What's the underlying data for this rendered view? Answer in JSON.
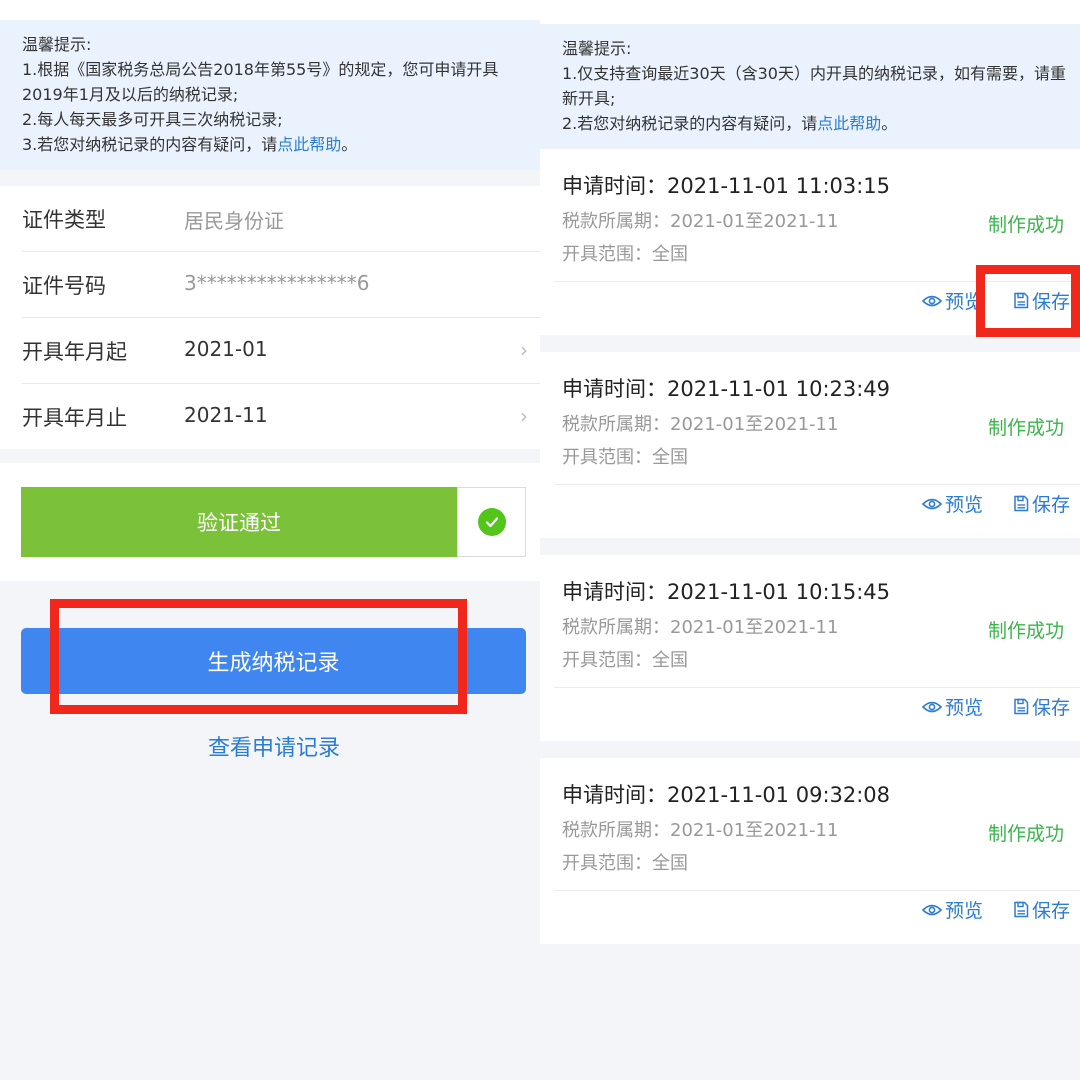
{
  "left": {
    "tips": {
      "title": "温馨提示:",
      "line1": "1.根据《国家税务总局公告2018年第55号》的规定，您可申请开具2019年1月及以后的纳税记录;",
      "line2": "2.每人每天最多可开具三次纳税记录;",
      "line3_prefix": "3.若您对纳税记录的内容有疑问，请",
      "line3_link": "点此帮助",
      "line3_suffix": "。"
    },
    "form": [
      {
        "label": "证件类型",
        "value": "居民身份证"
      },
      {
        "label": "证件号码",
        "value": "3****************6"
      },
      {
        "label": "开具年月起",
        "value": "2021-01"
      },
      {
        "label": "开具年月止",
        "value": "2021-11"
      }
    ],
    "verify_label": "验证通过",
    "generate_label": "生成纳税记录",
    "view_records_label": "查看申请记录"
  },
  "right": {
    "tips": {
      "title": "温馨提示:",
      "line1": "1.仅支持查询最近30天（含30天）内开具的纳税记录，如有需要，请重新开具;",
      "line2_prefix": "2.若您对纳税记录的内容有疑问，请",
      "line2_link": "点此帮助",
      "line2_suffix": "。"
    },
    "records": [
      {
        "time": "申请时间：2021-11-01 11:03:15",
        "period": "税款所属期：2021-01至2021-11",
        "scope": "开具范围：全国",
        "status": "制作成功",
        "preview": "预览",
        "save": "保存"
      },
      {
        "time": "申请时间：2021-11-01 10:23:49",
        "period": "税款所属期：2021-01至2021-11",
        "scope": "开具范围：全国",
        "status": "制作成功",
        "preview": "预览",
        "save": "保存"
      },
      {
        "time": "申请时间：2021-11-01 10:15:45",
        "period": "税款所属期：2021-01至2021-11",
        "scope": "开具范围：全国",
        "status": "制作成功",
        "preview": "预览",
        "save": "保存"
      },
      {
        "time": "申请时间：2021-11-01 09:32:08",
        "period": "税款所属期：2021-01至2021-11",
        "scope": "开具范围：全国",
        "status": "制作成功",
        "preview": "预览",
        "save": "保存"
      }
    ]
  },
  "colors": {
    "accent_blue": "#3f86f0",
    "link_blue": "#2b7cd3",
    "verify_green": "#7bc13a",
    "status_green": "#3ab54a",
    "highlight_red": "#f2271b"
  },
  "icons": [
    "check-icon",
    "eye-icon",
    "save-icon",
    "chevron-right-icon",
    "back-arrow-icon"
  ]
}
